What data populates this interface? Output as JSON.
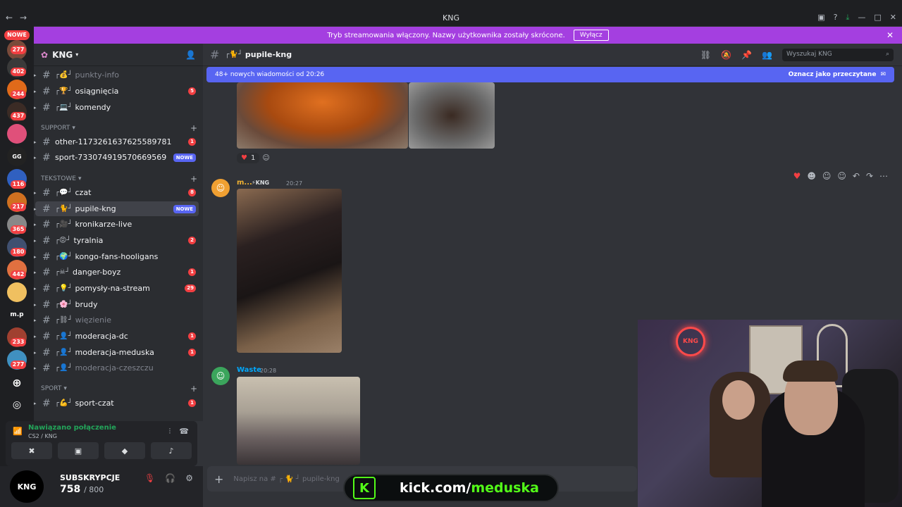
{
  "window": {
    "title": "KNG"
  },
  "banner": {
    "text": "Tryb streamowania włączony. Nazwy użytkownika zostały skrócone.",
    "button": "Wyłącz"
  },
  "guilds": {
    "nowe": "NOWE",
    "badges": [
      "277",
      "402",
      "244",
      "437",
      "116",
      "217",
      "365",
      "180",
      "442",
      "233",
      "277"
    ],
    "mp_label": "m.p"
  },
  "server": {
    "name": "KNG"
  },
  "channels": [
    {
      "name": "punkty-info",
      "badge": "",
      "muted": true
    },
    {
      "name": "osiągnięcia",
      "badge": "5"
    },
    {
      "name": "komendy",
      "badge": ""
    },
    {
      "name": "other-1173261637625589781",
      "badge": "1"
    },
    {
      "name": "sport-733074919570669569",
      "badge": "NOWE"
    },
    {
      "name": "czat",
      "badge": "8"
    },
    {
      "name": "pupile-kng",
      "badge": "NOWE"
    },
    {
      "name": "kronikarze-live",
      "badge": ""
    },
    {
      "name": "tyralnia",
      "badge": "2"
    },
    {
      "name": "kongo-fans-hooligans",
      "badge": ""
    },
    {
      "name": "danger-boyz",
      "badge": "1"
    },
    {
      "name": "pomysły-na-stream",
      "badge": "29"
    },
    {
      "name": "brudy",
      "badge": ""
    },
    {
      "name": "więzienie",
      "badge": "",
      "muted": true
    },
    {
      "name": "moderacja-dc",
      "badge": "1"
    },
    {
      "name": "moderacja-meduska",
      "badge": "1"
    },
    {
      "name": "moderacja-czeszczu",
      "badge": "",
      "muted": true
    },
    {
      "name": "sport-czat",
      "badge": "1"
    }
  ],
  "categories": {
    "support": "SUPPORT",
    "tekstowe": "TEKSTOWE",
    "sport": "SPORT"
  },
  "voice": {
    "status": "Nawiązano połączenie",
    "channel": "CS2 / KNG"
  },
  "user": {
    "subs_label": "SUBSKRYPCJE",
    "subs_count": "758",
    "subs_goal": "/ 800",
    "avatar_text": "KNG"
  },
  "header": {
    "channel": "pupile-kng",
    "search_placeholder": "Wyszukaj KNG"
  },
  "newbar": {
    "text": "48+ nowych wiadomości od 20:26",
    "mark": "Oznacz jako przeczytane"
  },
  "messages": [
    {
      "reaction_count": "1"
    },
    {
      "author": "m...",
      "tag": "⚡KNG",
      "time": "20:27"
    },
    {
      "author": "Waste",
      "time": "20:28"
    }
  ],
  "composer": {
    "placeholder": "Napisz na # ┌ 🐈 ┘ pupile-kng"
  },
  "overlay": {
    "kick_prefix": "kick.com/",
    "kick_name": "meduska",
    "kick_logo": "K",
    "neon": "KNG"
  },
  "colors": {
    "accent": "#5865f2",
    "banner": "#a43fe0",
    "badge": "#f23f42",
    "kick": "#53fc18"
  }
}
